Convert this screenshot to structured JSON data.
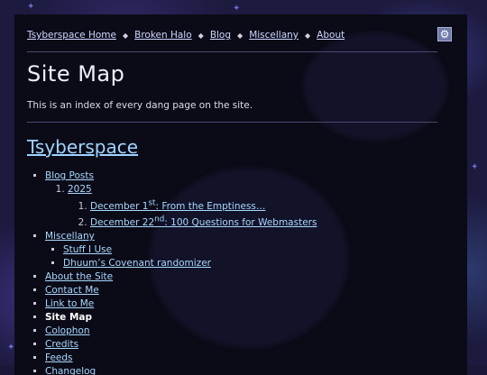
{
  "nav": {
    "items": [
      "Tsyberspace Home",
      "Broken Halo",
      "Blog",
      "Miscellany",
      "About"
    ],
    "separator": "◆",
    "theme_icon": "gear-icon",
    "theme_glyph": "⚙"
  },
  "page": {
    "title": "Site Map",
    "intro": "This is an index of every dang page on the site."
  },
  "sitemap": {
    "heading": "Tsyberspace",
    "blog_posts": "Blog Posts",
    "year": "2025",
    "post1": {
      "pre": "December 1",
      "sup": "st",
      "post": ": From the Emptiness…"
    },
    "post2": {
      "pre": "December 22",
      "sup": "nd",
      "post": ": 100 Questions for Webmasters"
    },
    "miscellany": "Miscellany",
    "misc_items": [
      "Stuff I Use",
      "Dhuum’s Covenant randomizer"
    ],
    "pages": [
      "About the Site",
      "Contact Me",
      "Link to Me",
      "Site Map",
      "Colophon",
      "Credits",
      "Feeds",
      "Changelog"
    ]
  },
  "colors": {
    "link": "#a8d8ff",
    "heading_link": "#9fd4ff",
    "panel": "#0b0b17",
    "background": "#1c1a3e"
  }
}
